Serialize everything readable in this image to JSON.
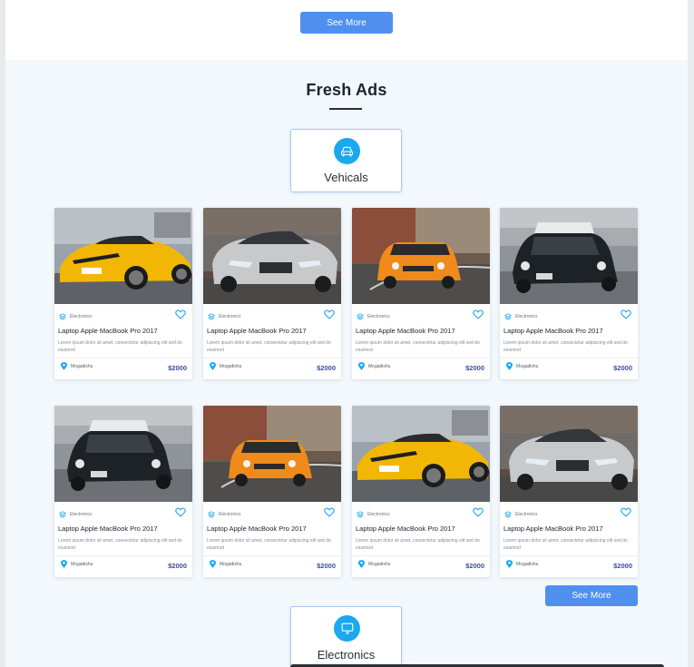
{
  "top": {
    "see_more_label": "See More"
  },
  "section": {
    "title": "Fresh Ads"
  },
  "categories": {
    "vehicles": {
      "label": "Vehicals",
      "icon": "car-icon"
    },
    "electronics": {
      "label": "Electronics",
      "icon": "monitor-icon"
    }
  },
  "bottom": {
    "see_more_label": "See More"
  },
  "colors": {
    "accent": "#4f8ff0",
    "icon_bg": "#1aa8ef",
    "price": "#3b4d9e"
  },
  "cards": [
    {
      "image": "yellow-camaro",
      "category": "Electronics",
      "title": "Laptop Apple MacBook Pro 2017",
      "description": "Lorem ipsum dolor sit amet, consectetur adipiscing elit sed do eiusmod",
      "location": "Mogadishu",
      "price": "$2000"
    },
    {
      "image": "silver-mustang",
      "category": "Electronics",
      "title": "Laptop Apple MacBook Pro 2017",
      "description": "Lorem ipsum dolor sit amet, consectetur adipiscing elit sed do eiusmod",
      "location": "Mogadishu",
      "price": "$2000"
    },
    {
      "image": "orange-mini",
      "category": "Electronics",
      "title": "Laptop Apple MacBook Pro 2017",
      "description": "Lorem ipsum dolor sit amet, consectetur adipiscing elit sed do eiusmod",
      "location": "Mogadishu",
      "price": "$2000"
    },
    {
      "image": "black-mini",
      "category": "Electronics",
      "title": "Laptop Apple MacBook Pro 2017",
      "description": "Lorem ipsum dolor sit amet, consectetur adipiscing elit sed do eiusmod",
      "location": "Mogadishu",
      "price": "$2000"
    },
    {
      "image": "black-mini",
      "category": "Electronics",
      "title": "Laptop Apple MacBook Pro 2017",
      "description": "Lorem ipsum dolor sit amet, consectetur adipiscing elit sed do eiusmod",
      "location": "Mogadishu",
      "price": "$2000"
    },
    {
      "image": "orange-mini",
      "category": "Electronics",
      "title": "Laptop Apple MacBook Pro 2017",
      "description": "Lorem ipsum dolor sit amet, consectetur adipiscing elit sed do eiusmod",
      "location": "Mogadishu",
      "price": "$2000"
    },
    {
      "image": "yellow-camaro",
      "category": "Electronics",
      "title": "Laptop Apple MacBook Pro 2017",
      "description": "Lorem ipsum dolor sit amet, consectetur adipiscing elit sed do eiusmod",
      "location": "Mogadishu",
      "price": "$2000"
    },
    {
      "image": "silver-mustang",
      "category": "Electronics",
      "title": "Laptop Apple MacBook Pro 2017",
      "description": "Lorem ipsum dolor sit amet, consectetur adipiscing elit sed do eiusmod",
      "location": "Mogadishu",
      "price": "$2000"
    }
  ]
}
